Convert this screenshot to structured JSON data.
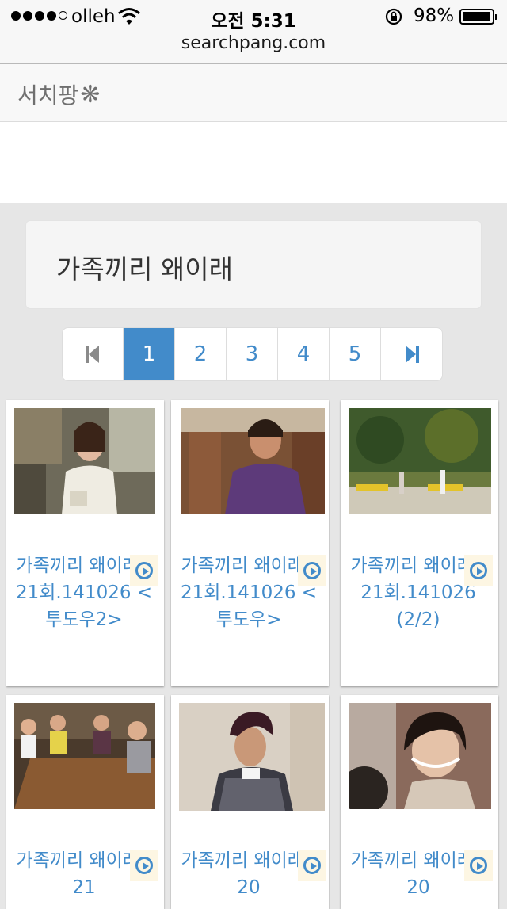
{
  "status_bar": {
    "carrier": "olleh",
    "time": "오전 5:31",
    "battery_percent": "98%",
    "battery_level": 0.98
  },
  "browser": {
    "url": "searchpang.com"
  },
  "site": {
    "logo_text": "서치팡",
    "logo_icon": "asterisk-flower-icon"
  },
  "title": "가족끼리 왜이래",
  "pagination": {
    "first_icon": "skip-to-first-icon",
    "last_icon": "skip-to-last-icon",
    "pages": [
      "1",
      "2",
      "3",
      "4",
      "5"
    ],
    "active": "1"
  },
  "videos": [
    {
      "title": "가족끼리 왜이래 - 21회.141026 <투도우2>",
      "thumb": "woman-reading-outdoors"
    },
    {
      "title": "가족끼리 왜이래 - 21회.141026 <투도우>",
      "thumb": "older-woman-purple-apron"
    },
    {
      "title": "가족끼리 왜이래 - 21회.141026 (2/2)",
      "thumb": "park-benches-scene"
    },
    {
      "title": "가족끼리 왜이래 - 21",
      "thumb": "family-at-table"
    },
    {
      "title": "가족끼리 왜이래 - 20",
      "thumb": "woman-houndstooth-jacket"
    },
    {
      "title": "가족끼리 왜이래 - 20",
      "thumb": "smiling-young-woman"
    }
  ],
  "colors": {
    "accent": "#428bca",
    "background": "#e6e6e6"
  }
}
